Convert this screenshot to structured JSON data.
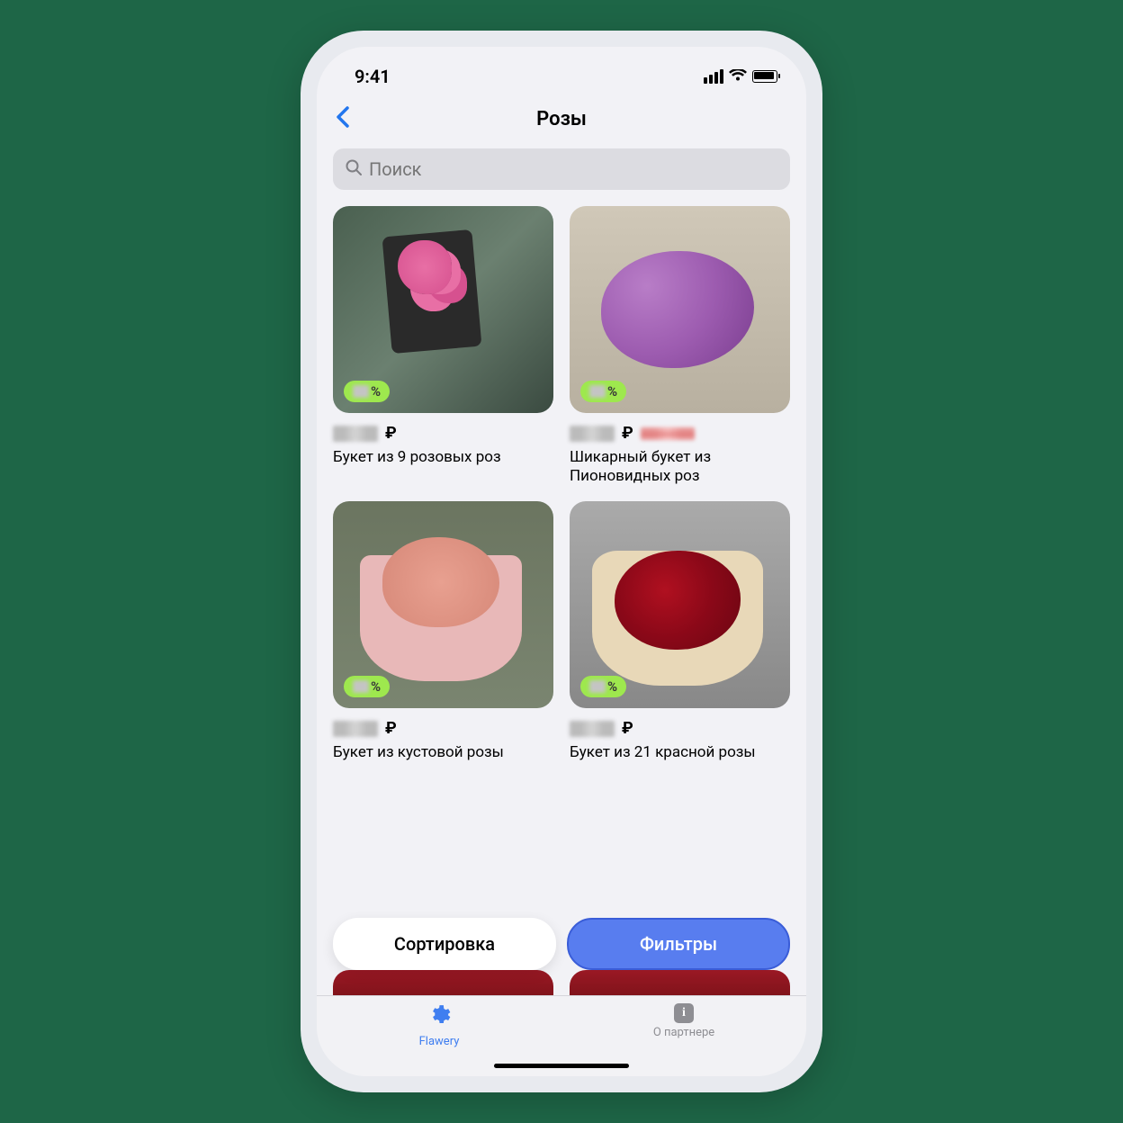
{
  "status": {
    "time": "9:41"
  },
  "header": {
    "title": "Розы"
  },
  "search": {
    "placeholder": "Поиск"
  },
  "products": [
    {
      "discount_symbol": "%",
      "currency": "₽",
      "has_old_price": false,
      "name": "Букет из 9 розовых роз"
    },
    {
      "discount_symbol": "%",
      "currency": "₽",
      "has_old_price": true,
      "name": "Шикарный букет из Пионовидных роз"
    },
    {
      "discount_symbol": "%",
      "currency": "₽",
      "has_old_price": false,
      "name": "Букет из кустовой розы"
    },
    {
      "discount_symbol": "%",
      "currency": "₽",
      "has_old_price": false,
      "name": "Букет из 21 красной розы"
    }
  ],
  "actions": {
    "sort": "Сортировка",
    "filter": "Фильтры"
  },
  "tabs": {
    "primary": "Flawery",
    "about": "О партнере"
  }
}
